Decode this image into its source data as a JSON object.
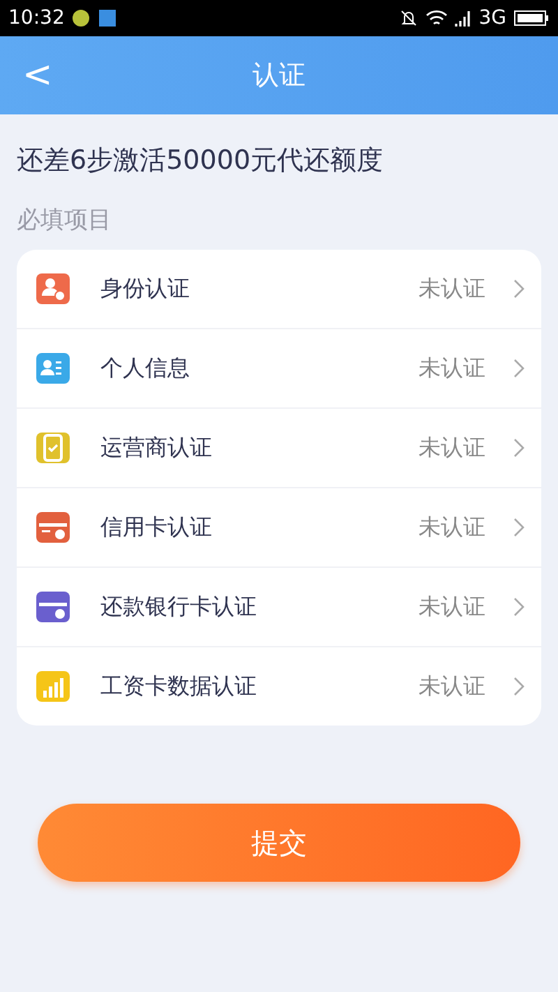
{
  "status_bar": {
    "time": "10:32",
    "network": "3G"
  },
  "header": {
    "back": "<",
    "title": "认证"
  },
  "progress_text": "还差6步激活50000元代还额度",
  "section_label": "必填项目",
  "items": [
    {
      "kind": "id",
      "label": "身份认证",
      "status": "未认证",
      "color": "#ee6a4a"
    },
    {
      "kind": "person",
      "label": "个人信息",
      "status": "未认证",
      "color": "#3aa9e8"
    },
    {
      "kind": "phone",
      "label": "运营商认证",
      "status": "未认证",
      "color": "#e0c12c"
    },
    {
      "kind": "credit",
      "label": "信用卡认证",
      "status": "未认证",
      "color": "#e2603e"
    },
    {
      "kind": "bank",
      "label": "还款银行卡认证",
      "status": "未认证",
      "color": "#6a5fce"
    },
    {
      "kind": "salary",
      "label": "工资卡数据认证",
      "status": "未认证",
      "color": "#f5c518"
    }
  ],
  "submit": "提交"
}
